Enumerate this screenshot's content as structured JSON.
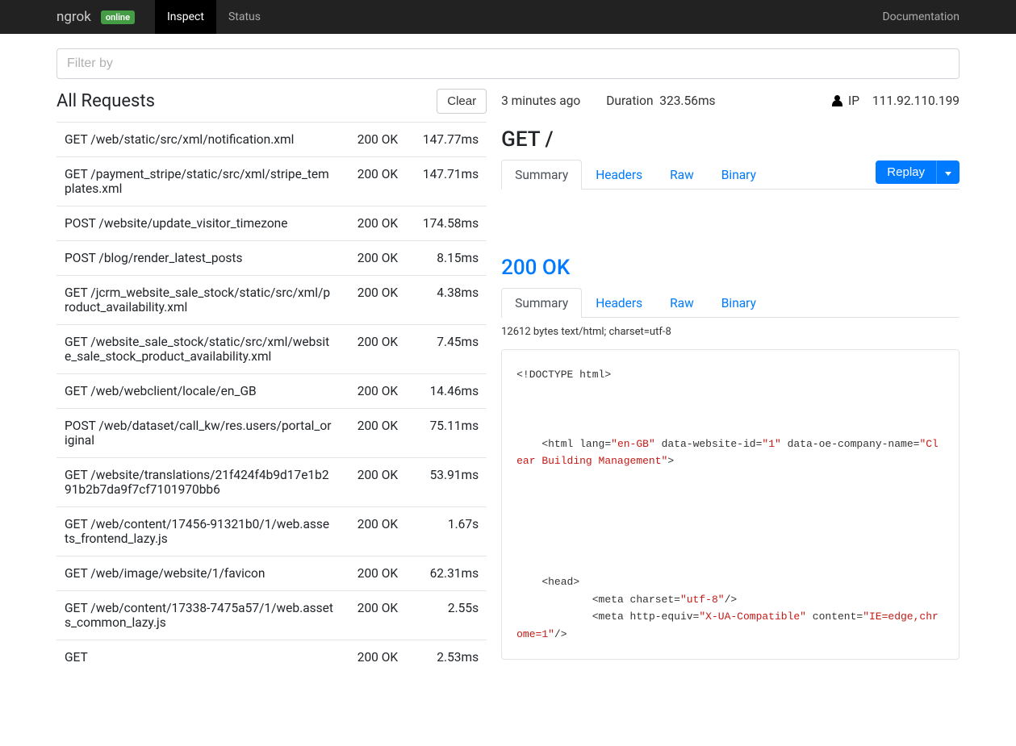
{
  "navbar": {
    "brand": "ngrok",
    "status_badge": "online",
    "tabs": [
      "Inspect",
      "Status"
    ],
    "active_tab": 0,
    "doc_link": "Documentation"
  },
  "filter": {
    "placeholder": "Filter by"
  },
  "list": {
    "title": "All Requests",
    "clear_label": "Clear",
    "items": [
      {
        "method": "GET",
        "path": "/web/static/src/xml/notification.xml",
        "status": "200 OK",
        "duration": "147.77ms"
      },
      {
        "method": "GET",
        "path": "/payment_stripe/static/src/xml/stripe_templates.xml",
        "status": "200 OK",
        "duration": "147.71ms"
      },
      {
        "method": "POST",
        "path": "/website/update_visitor_timezone",
        "status": "200 OK",
        "duration": "174.58ms"
      },
      {
        "method": "POST",
        "path": "/blog/render_latest_posts",
        "status": "200 OK",
        "duration": "8.15ms"
      },
      {
        "method": "GET",
        "path": "/jcrm_website_sale_stock/static/src/xml/product_availability.xml",
        "status": "200 OK",
        "duration": "4.38ms"
      },
      {
        "method": "GET",
        "path": "/website_sale_stock/static/src/xml/website_sale_stock_product_availability.xml",
        "status": "200 OK",
        "duration": "7.45ms"
      },
      {
        "method": "GET",
        "path": "/web/webclient/locale/en_GB",
        "status": "200 OK",
        "duration": "14.46ms"
      },
      {
        "method": "POST",
        "path": "/web/dataset/call_kw/res.users/portal_original",
        "status": "200 OK",
        "duration": "75.11ms"
      },
      {
        "method": "GET",
        "path": "/website/translations/21f424f4b9d17e1b291b2b7da9f7cf7101970bb6",
        "status": "200 OK",
        "duration": "53.91ms"
      },
      {
        "method": "GET",
        "path": "/web/content/17456-91321b0/1/web.assets_frontend_lazy.js",
        "status": "200 OK",
        "duration": "1.67s"
      },
      {
        "method": "GET",
        "path": "/web/image/website/1/favicon",
        "status": "200 OK",
        "duration": "62.31ms"
      },
      {
        "method": "GET",
        "path": "/web/content/17338-7475a57/1/web.assets_common_lazy.js",
        "status": "200 OK",
        "duration": "2.55s"
      },
      {
        "method": "GET",
        "path": "",
        "status": "200 OK",
        "duration": "2.53ms"
      }
    ]
  },
  "detail": {
    "timestamp": "3 minutes ago",
    "duration_label": "Duration",
    "duration_value": "323.56ms",
    "ip_label": "IP",
    "ip_value": "111.92.110.199",
    "title": "GET /",
    "tabs": [
      "Summary",
      "Headers",
      "Raw",
      "Binary"
    ],
    "replay_label": "Replay",
    "status_line": "200 OK",
    "resp_tabs": [
      "Summary",
      "Headers",
      "Raw",
      "Binary"
    ],
    "resp_meta": "12612 bytes text/html; charset=utf-8",
    "code": {
      "l1": "<!DOCTYPE html>",
      "l2a": "    <html lang=",
      "l2b": "\"en-GB\"",
      "l2c": " data-website-id=",
      "l2d": "\"1\"",
      "l2e": " data-oe-company-name=",
      "l2f": "\"Clear Building Management\"",
      "l2g": ">",
      "l3": "    <head>",
      "l4a": "            <meta charset=",
      "l4b": "\"utf-8\"",
      "l4c": "/>",
      "l5a": "            <meta http-equiv=",
      "l5b": "\"X-UA-Compatible\"",
      "l5c": " content=",
      "l5d": "\"IE=edge,chrome=1\"",
      "l5e": "/>"
    }
  }
}
